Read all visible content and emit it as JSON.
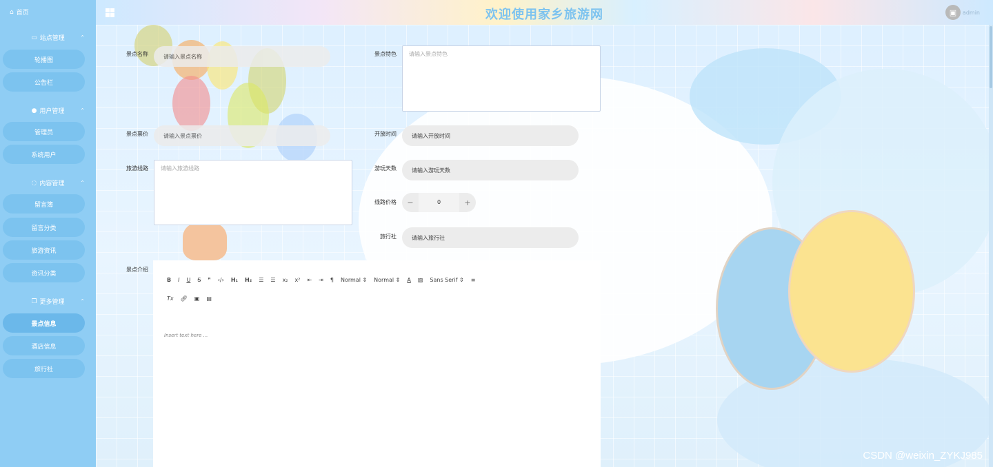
{
  "header": {
    "title": "欢迎使用家乡旅游网",
    "username": "admin"
  },
  "sidebar": {
    "home": "首页",
    "groups": [
      {
        "title": "站点管理",
        "items": [
          "轮播图",
          "公告栏"
        ]
      },
      {
        "title": "用户管理",
        "items": [
          "管理员",
          "系统用户"
        ]
      },
      {
        "title": "内容管理",
        "items": [
          "留言簿",
          "留言分类",
          "旅游资讯",
          "资讯分类"
        ]
      },
      {
        "title": "更多管理",
        "items": [
          "景点信息",
          "酒店信息",
          "旅行社"
        ]
      }
    ],
    "active_item": "景点信息"
  },
  "form": {
    "name": {
      "label": "景点名称",
      "placeholder": "请输入景点名称"
    },
    "feature": {
      "label": "景点特色",
      "placeholder": "请输入景点特色"
    },
    "ticket": {
      "label": "景点票价",
      "placeholder": "请输入景点票价"
    },
    "open_time": {
      "label": "开放时间",
      "placeholder": "请输入开放时间"
    },
    "route": {
      "label": "旅游线路",
      "placeholder": "请输入旅游线路"
    },
    "days": {
      "label": "游玩天数",
      "placeholder": "请输入游玩天数"
    },
    "price": {
      "label": "线路价格",
      "value": "0",
      "minus": "−",
      "plus": "+"
    },
    "agency": {
      "label": "旅行社",
      "placeholder": "请输入旅行社"
    },
    "intro": {
      "label": "景点介绍"
    }
  },
  "editor": {
    "header_select": "Normal",
    "size_select": "Normal",
    "font_select": "Sans Serif",
    "placeholder": "Insert text here ..."
  },
  "watermark": "CSDN @weixin_ZYKJ985",
  "colors": {
    "sidebar": "#8fcdf4",
    "nav_item": "#7cc3ef",
    "title": "#7dc3ef"
  }
}
